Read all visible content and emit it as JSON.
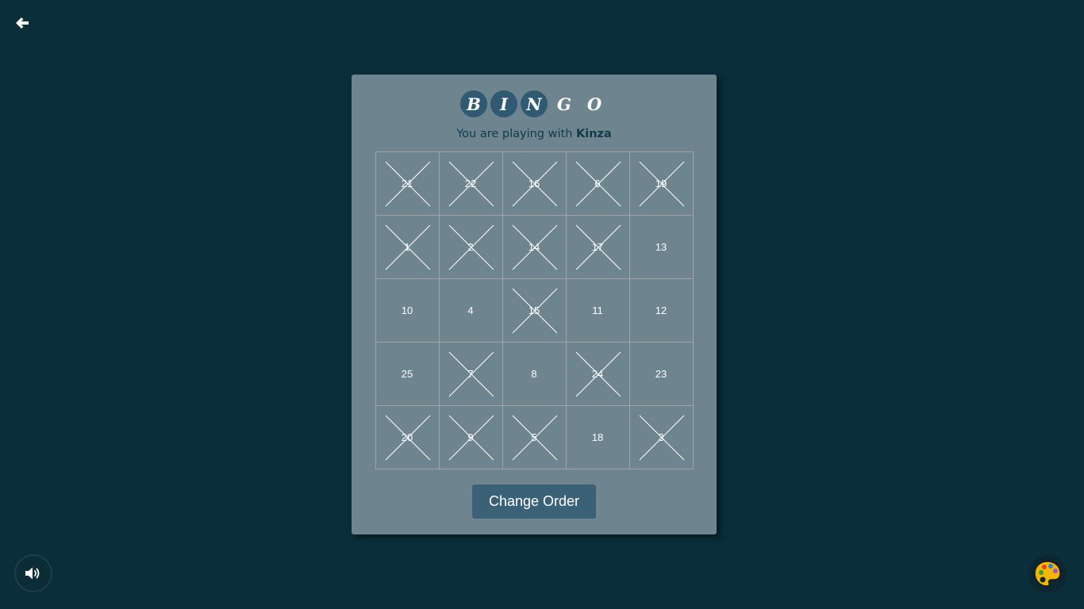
{
  "title_letters": [
    {
      "char": "B",
      "active": true
    },
    {
      "char": "I",
      "active": true
    },
    {
      "char": "N",
      "active": true
    },
    {
      "char": "G",
      "active": false
    },
    {
      "char": "O",
      "active": false
    }
  ],
  "status": {
    "prefix": "You are playing with ",
    "opponent": "Kinza"
  },
  "board": [
    [
      {
        "n": "21",
        "x": true
      },
      {
        "n": "22",
        "x": true
      },
      {
        "n": "16",
        "x": true
      },
      {
        "n": "6",
        "x": true
      },
      {
        "n": "19",
        "x": true
      }
    ],
    [
      {
        "n": "1",
        "x": true
      },
      {
        "n": "2",
        "x": true
      },
      {
        "n": "14",
        "x": true
      },
      {
        "n": "17",
        "x": true
      },
      {
        "n": "13",
        "x": false
      }
    ],
    [
      {
        "n": "10",
        "x": false
      },
      {
        "n": "4",
        "x": false
      },
      {
        "n": "15",
        "x": true
      },
      {
        "n": "11",
        "x": false
      },
      {
        "n": "12",
        "x": false
      }
    ],
    [
      {
        "n": "25",
        "x": false
      },
      {
        "n": "7",
        "x": true
      },
      {
        "n": "8",
        "x": false
      },
      {
        "n": "24",
        "x": true
      },
      {
        "n": "23",
        "x": false
      }
    ],
    [
      {
        "n": "20",
        "x": true
      },
      {
        "n": "9",
        "x": true
      },
      {
        "n": "5",
        "x": true
      },
      {
        "n": "18",
        "x": false
      },
      {
        "n": "3",
        "x": true
      }
    ]
  ],
  "change_order_label": "Change Order",
  "icons": {
    "back": "arrow-left-icon",
    "sound": "volume-icon",
    "theme": "palette-icon"
  },
  "colors": {
    "background": "#0a2f3a",
    "card": "#6e8590",
    "active_letter": "#2f5a71",
    "button": "#3b6176"
  }
}
